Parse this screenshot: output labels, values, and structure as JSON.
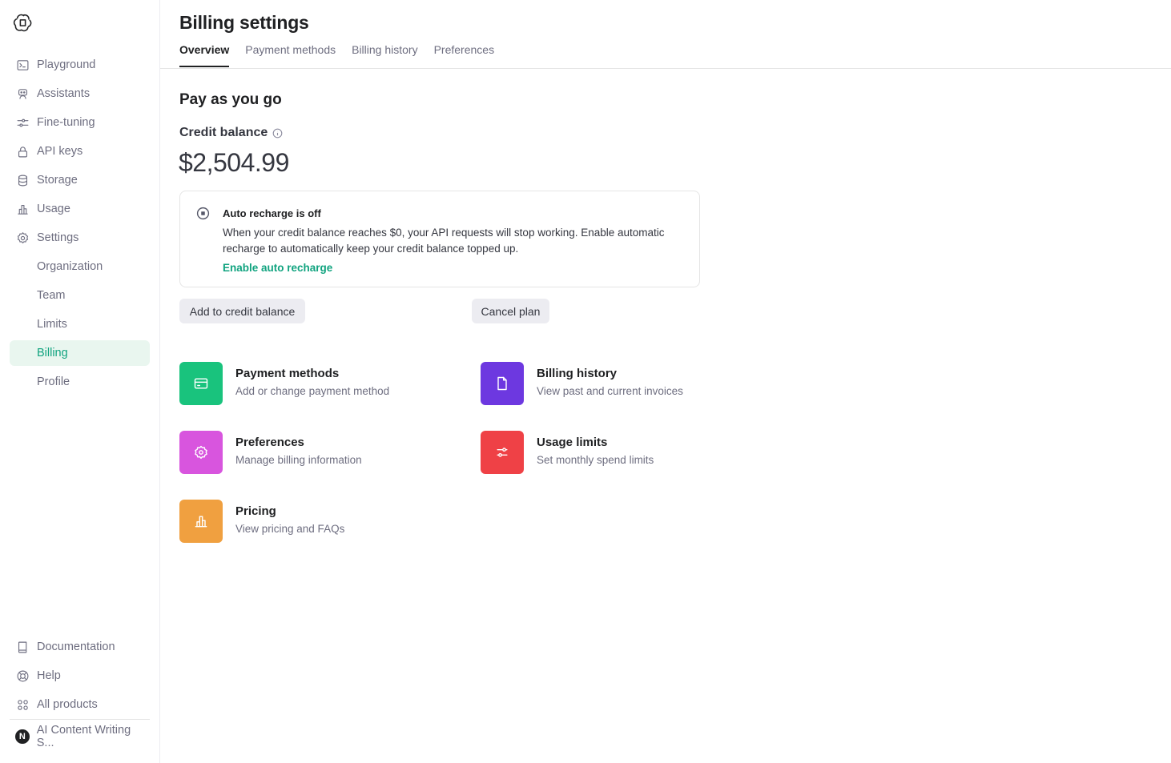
{
  "colors": {
    "accent": "#10a37f",
    "active_bg": "#e9f6ef",
    "payment_tile": "#19c37d",
    "history_tile": "#6d38e0",
    "preferences_tile": "#d855de",
    "usage_tile": "#ef4146",
    "pricing_tile": "#f0a040"
  },
  "sidebar": {
    "logo_icon": "openai-logo-icon",
    "items": [
      {
        "label": "Playground",
        "icon": "terminal-icon"
      },
      {
        "label": "Assistants",
        "icon": "robot-icon"
      },
      {
        "label": "Fine-tuning",
        "icon": "sliders-icon"
      },
      {
        "label": "API keys",
        "icon": "lock-icon"
      },
      {
        "label": "Storage",
        "icon": "database-icon"
      },
      {
        "label": "Usage",
        "icon": "bar-chart-icon"
      },
      {
        "label": "Settings",
        "icon": "gear-icon"
      }
    ],
    "sub_items": [
      {
        "label": "Organization"
      },
      {
        "label": "Team"
      },
      {
        "label": "Limits"
      },
      {
        "label": "Billing",
        "active": true
      },
      {
        "label": "Profile"
      }
    ],
    "bottom": [
      {
        "label": "Documentation",
        "icon": "book-icon"
      },
      {
        "label": "Help",
        "icon": "lifebuoy-icon"
      },
      {
        "label": "All products",
        "icon": "grid-icon"
      }
    ],
    "org": {
      "initial": "N",
      "name": "AI Content Writing S..."
    }
  },
  "header": {
    "title": "Billing settings",
    "tabs": [
      {
        "label": "Overview",
        "active": true
      },
      {
        "label": "Payment methods"
      },
      {
        "label": "Billing history"
      },
      {
        "label": "Preferences"
      }
    ]
  },
  "overview": {
    "plan_title": "Pay as you go",
    "credit_label": "Credit balance",
    "credit_amount": "$2,504.99",
    "recharge": {
      "title": "Auto recharge is off",
      "description": "When your credit balance reaches $0, your API requests will stop working. Enable automatic recharge to automatically keep your credit balance topped up.",
      "link": "Enable auto recharge"
    },
    "buttons": {
      "add_credit": "Add to credit balance",
      "cancel_plan": "Cancel plan"
    },
    "cards": [
      {
        "title": "Payment methods",
        "subtitle": "Add or change payment method",
        "icon": "credit-card-icon"
      },
      {
        "title": "Billing history",
        "subtitle": "View past and current invoices",
        "icon": "document-icon"
      },
      {
        "title": "Preferences",
        "subtitle": "Manage billing information",
        "icon": "gear-icon"
      },
      {
        "title": "Usage limits",
        "subtitle": "Set monthly spend limits",
        "icon": "sliders-icon"
      },
      {
        "title": "Pricing",
        "subtitle": "View pricing and FAQs",
        "icon": "bar-chart-icon"
      }
    ]
  }
}
